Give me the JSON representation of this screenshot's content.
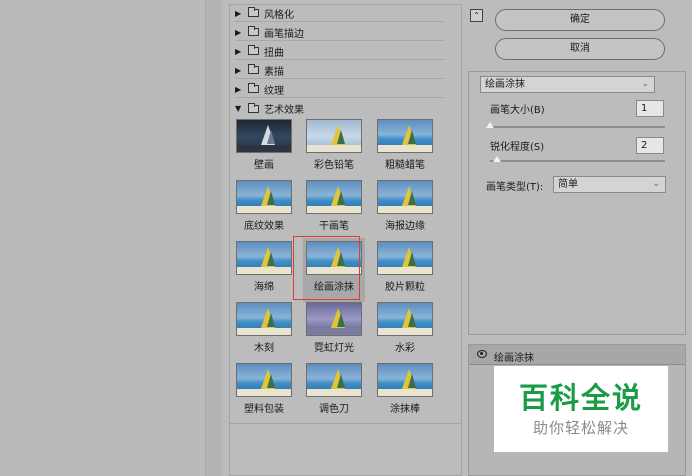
{
  "categories": [
    {
      "label": "风格化",
      "expanded": false
    },
    {
      "label": "画笔描边",
      "expanded": false
    },
    {
      "label": "扭曲",
      "expanded": false
    },
    {
      "label": "素描",
      "expanded": false
    },
    {
      "label": "纹理",
      "expanded": false
    },
    {
      "label": "艺术效果",
      "expanded": true
    }
  ],
  "filters": [
    {
      "label": "壁画",
      "icon": "filter-thumbnail-icon"
    },
    {
      "label": "彩色铅笔",
      "icon": "filter-thumbnail-icon"
    },
    {
      "label": "粗糙蜡笔",
      "icon": "filter-thumbnail-icon"
    },
    {
      "label": "底纹效果",
      "icon": "filter-thumbnail-icon"
    },
    {
      "label": "干画笔",
      "icon": "filter-thumbnail-icon"
    },
    {
      "label": "海报边缘",
      "icon": "filter-thumbnail-icon"
    },
    {
      "label": "海绵",
      "icon": "filter-thumbnail-icon"
    },
    {
      "label": "绘画涂抹",
      "icon": "filter-thumbnail-icon",
      "selected": true
    },
    {
      "label": "胶片颗粒",
      "icon": "filter-thumbnail-icon"
    },
    {
      "label": "木刻",
      "icon": "filter-thumbnail-icon"
    },
    {
      "label": "霓虹灯光",
      "icon": "filter-thumbnail-icon"
    },
    {
      "label": "水彩",
      "icon": "filter-thumbnail-icon"
    },
    {
      "label": "塑料包装",
      "icon": "filter-thumbnail-icon"
    },
    {
      "label": "调色刀",
      "icon": "filter-thumbnail-icon"
    },
    {
      "label": "涂抹棒",
      "icon": "filter-thumbnail-icon"
    }
  ],
  "buttons": {
    "ok": "确定",
    "cancel": "取消"
  },
  "settings": {
    "filter_select": "绘画涂抹",
    "brush_size_label": "画笔大小(B)",
    "brush_size_value": "1",
    "sharpness_label": "锐化程度(S)",
    "sharpness_value": "2",
    "brush_type_label": "画笔类型(T):",
    "brush_type_value": "简单"
  },
  "layers": {
    "active_layer": "绘画涂抹"
  },
  "watermark": {
    "title": "百科全说",
    "subtitle": "助你轻松解决"
  },
  "colors": {
    "selection_outline": "#e03a3a",
    "watermark_green": "#1a9b45"
  }
}
